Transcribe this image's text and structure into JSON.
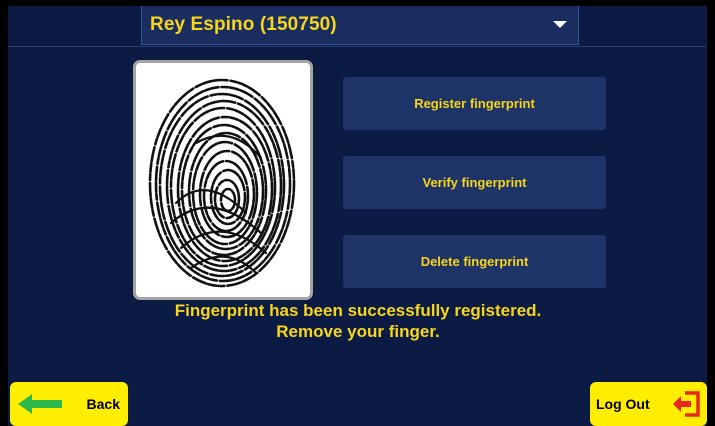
{
  "header": {
    "selected_user": "Rey Espino (150750)",
    "dropdown_icon": "caret-down-icon"
  },
  "fingerprint": {
    "image_icon": "fingerprint-icon"
  },
  "actions": {
    "register_label": "Register fingerprint",
    "verify_label": "Verify fingerprint",
    "delete_label": "Delete fingerprint"
  },
  "status": {
    "line1": "Fingerprint has been successfully registered.",
    "line2": "Remove your finger."
  },
  "footer": {
    "back_label": "Back",
    "back_icon": "arrow-left-icon",
    "logout_label": "Log Out",
    "logout_icon": "logout-icon"
  },
  "colors": {
    "background": "#0b1b43",
    "button": "#1e3468",
    "accent_text": "#f7d51a",
    "footer_button": "#ffee00",
    "back_arrow": "#2db84b",
    "logout_icon": "#e8281f"
  }
}
